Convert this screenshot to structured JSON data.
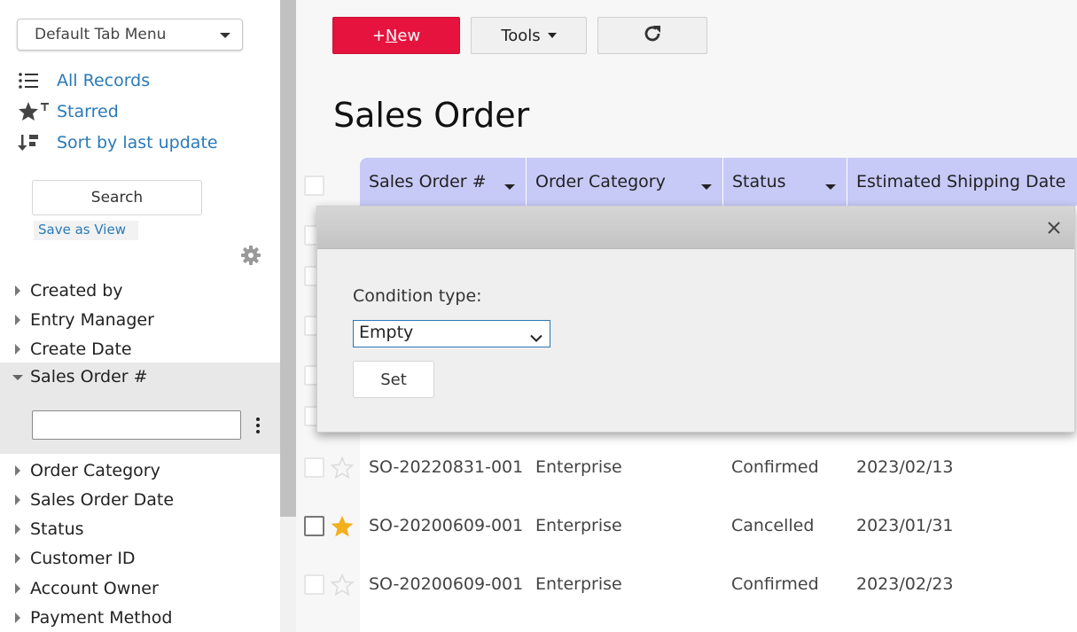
{
  "sidebar": {
    "tab_menu": "Default Tab Menu",
    "nav": {
      "all_records": "All Records",
      "starred": "Starred",
      "sort_by_last_update": "Sort by last update"
    },
    "search_label": "Search",
    "save_as_view": "Save as View",
    "filters_before": [
      "Created by",
      "Entry Manager",
      "Create Date"
    ],
    "filter_expanded": {
      "label": "Sales Order #",
      "value": ""
    },
    "filters_after": [
      "Order Category",
      "Sales Order Date",
      "Status",
      "Customer ID",
      "Account Owner",
      "Payment Method"
    ]
  },
  "toolbar": {
    "new_prefix": "+",
    "new_mnemonic": "N",
    "new_rest": "ew",
    "tools_label": "Tools"
  },
  "page_title": "Sales Order",
  "table": {
    "columns": [
      "Sales Order #",
      "Order Category",
      "Status",
      "Estimated Shipping Date"
    ],
    "rows": [
      {
        "starred": false,
        "checkbox_dark": false,
        "cells": [
          "SO-20220831-001",
          "Enterprise",
          "Confirmed",
          "2023/02/13"
        ]
      },
      {
        "starred": true,
        "checkbox_dark": true,
        "cells": [
          "SO-20200609-001",
          "Enterprise",
          "Cancelled",
          "2023/01/31"
        ]
      },
      {
        "starred": false,
        "checkbox_dark": false,
        "cells": [
          "SO-20200609-001",
          "Enterprise",
          "Confirmed",
          "2023/02/23"
        ]
      }
    ]
  },
  "dialog": {
    "condition_label": "Condition type:",
    "condition_value": "Empty",
    "set_label": "Set"
  },
  "colors": {
    "new_button": "#e5133e",
    "header": "#c7c9f7",
    "link": "#2a7ab8",
    "star_active": "#f2b01e"
  }
}
